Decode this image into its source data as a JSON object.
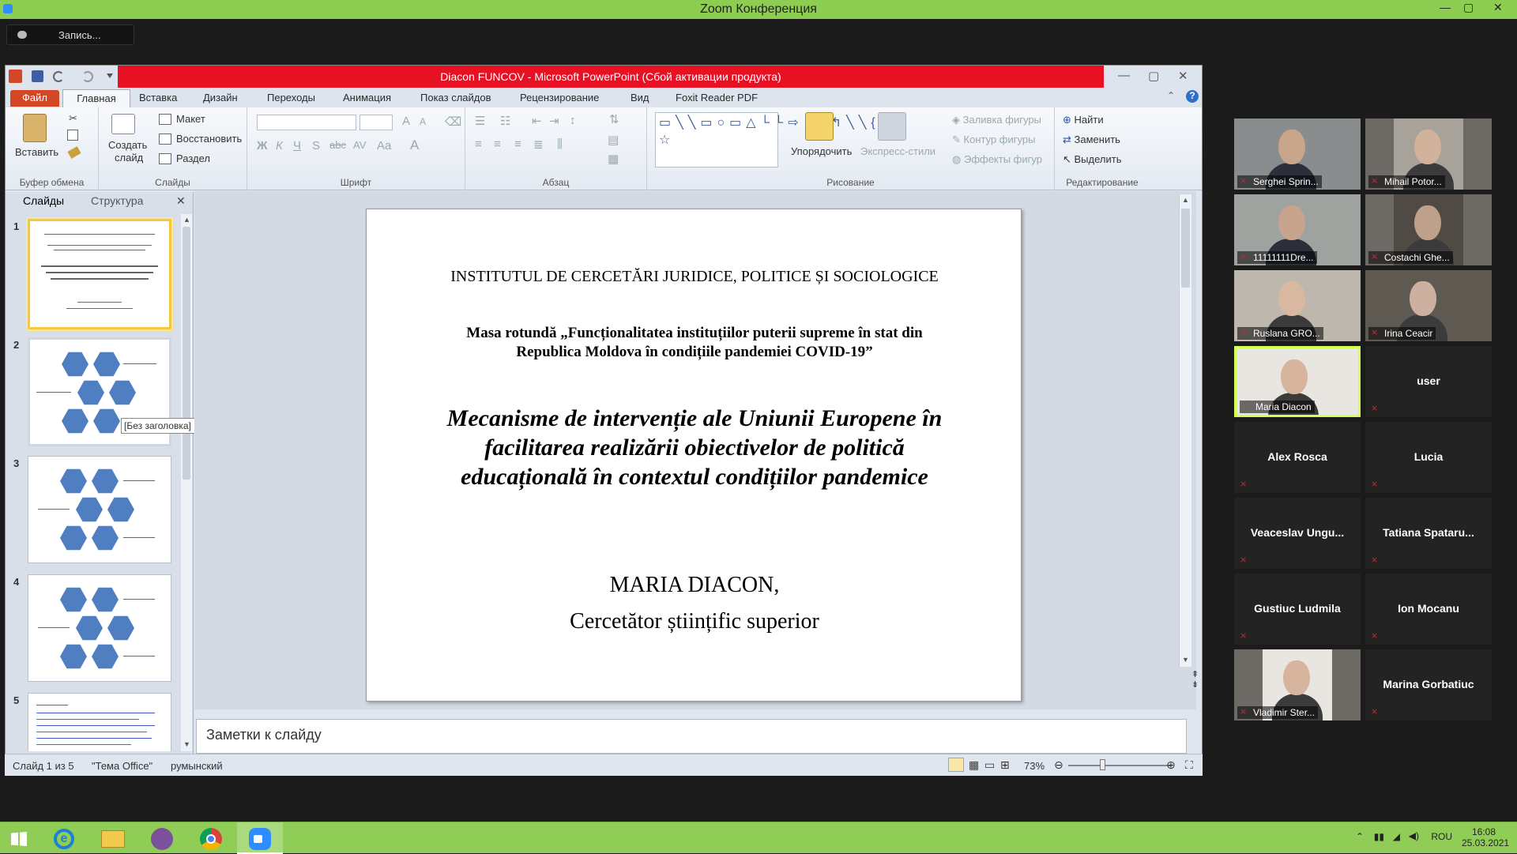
{
  "zoom": {
    "window_title": "Zoom Конференция",
    "recording_label": "Запись...",
    "win_min": "—",
    "win_max": "▢",
    "win_close": "✕"
  },
  "ppt": {
    "title": "Diacon FUNCOV  -  Microsoft PowerPoint (Сбой активации продукта)",
    "tabs": {
      "file": "Файл",
      "home": "Главная",
      "insert": "Вставка",
      "design": "Дизайн",
      "transitions": "Переходы",
      "animation": "Анимация",
      "slideshow": "Показ слайдов",
      "review": "Рецензирование",
      "view": "Вид",
      "foxit": "Foxit Reader PDF"
    },
    "ribbon": {
      "clipboard": {
        "paste": "Вставить",
        "label": "Буфер обмена"
      },
      "slides": {
        "new_slide_1": "Создать",
        "new_slide_2": "слайд",
        "layout": "Макет",
        "reset": "Восстановить",
        "section": "Раздел",
        "label": "Слайды"
      },
      "font": {
        "label": "Шрифт"
      },
      "paragraph": {
        "label": "Абзац"
      },
      "drawing": {
        "arrange": "Упорядочить",
        "quick_styles": "Экспресс-стили",
        "fill": "Заливка фигуры",
        "outline": "Контур фигуры",
        "effects": "Эффекты фигур",
        "label": "Рисование"
      },
      "editing": {
        "find": "Найти",
        "replace": "Заменить",
        "select": "Выделить",
        "label": "Редактирование"
      }
    },
    "panel": {
      "tab_slides": "Слайды",
      "tab_outline": "Структура",
      "close": "✕",
      "thumb_numbers": [
        "1",
        "2",
        "3",
        "4",
        "5"
      ],
      "tooltip": "[Без заголовка]"
    },
    "slide": {
      "institute": "INSTITUTUL  DE  CERCETĂRI  JURIDICE,  POLITICE  ȘI  SOCIOLOGICE",
      "round_table_1": "Masa rotundă „Funcționalitatea  instituțiilor  puterii  supreme  în  stat  din",
      "round_table_2": "Republica  Moldova  în  condițiile  pandemiei  COVID-19”",
      "main_title_1": "Mecanisme de intervenție ale Uniunii Europene în",
      "main_title_2": "facilitarea realizării obiectivelor de politică",
      "main_title_3": "educațională în contextul condițiilor pandemice",
      "author": "MARIA DIACON,",
      "position": "Cercetător  științific  superior"
    },
    "notes_placeholder": "Заметки к слайду",
    "status": {
      "slide_count": "Слайд 1 из 5",
      "theme": "\"Тема Office\"",
      "language": "румынский",
      "zoom": "73%"
    }
  },
  "participants": [
    {
      "name": "Serghei Sprin...",
      "video": true
    },
    {
      "name": "Mihail Potor...",
      "video": true
    },
    {
      "name": "11111111Dre...",
      "video": true
    },
    {
      "name": "Costachi Ghe...",
      "video": true
    },
    {
      "name": "Ruslana GRO...",
      "video": true
    },
    {
      "name": "Irina Ceacir",
      "video": true
    },
    {
      "name": "Maria Diacon",
      "video": true
    },
    {
      "name": "user",
      "video": false
    },
    {
      "name": "Alex Rosca",
      "video": false
    },
    {
      "name": "Lucia",
      "video": false
    },
    {
      "name": "Veaceslav  Ungu...",
      "video": false
    },
    {
      "name": "Tatiana  Spataru...",
      "video": false
    },
    {
      "name": "Gustiuc Ludmila",
      "video": false
    },
    {
      "name": "Ion Mocanu",
      "video": false
    },
    {
      "name": "Vladimir Ster...",
      "video": true
    },
    {
      "name": "Marina Gorbatiuc",
      "video": false
    }
  ],
  "taskbar": {
    "lang": "ROU",
    "time": "16:08",
    "date": "25.03.2021"
  },
  "colors": {
    "zoom_green": "#8ccd52",
    "ppt_red": "#e81123",
    "file_tab": "#d24726",
    "hex_blue": "#4f7fc1",
    "active_speaker": "#d6ff54"
  }
}
